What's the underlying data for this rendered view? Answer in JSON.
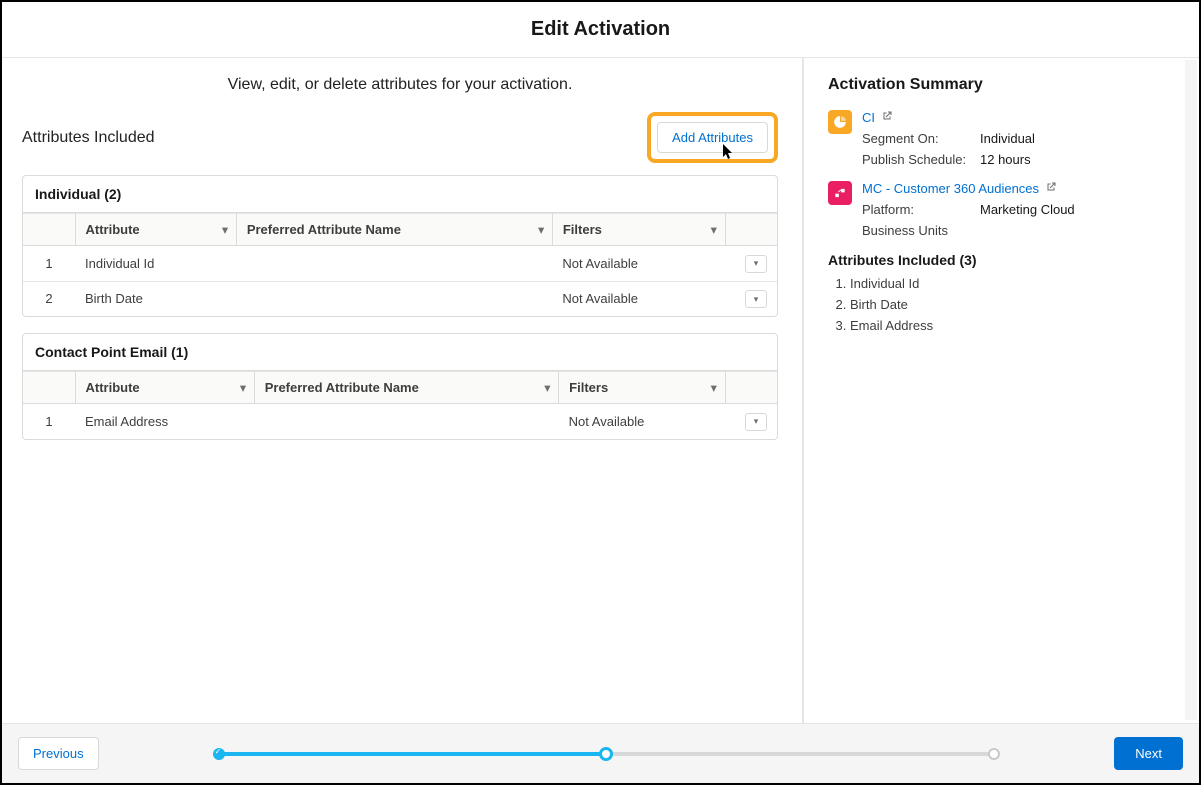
{
  "modal": {
    "title": "Edit Activation"
  },
  "main": {
    "description": "View, edit, or delete attributes for your activation.",
    "attrs_title": "Attributes Included",
    "add_button": "Add Attributes",
    "groups": [
      {
        "title": "Individual (2)",
        "columns": {
          "attr": "Attribute",
          "pref": "Preferred Attribute Name",
          "filters": "Filters"
        },
        "rows": [
          {
            "num": "1",
            "attr": "Individual Id",
            "pref": "",
            "filters": "Not Available"
          },
          {
            "num": "2",
            "attr": "Birth Date",
            "pref": "",
            "filters": "Not Available"
          }
        ]
      },
      {
        "title": "Contact Point Email (1)",
        "columns": {
          "attr": "Attribute",
          "pref": "Preferred Attribute Name",
          "filters": "Filters"
        },
        "rows": [
          {
            "num": "1",
            "attr": "Email Address",
            "pref": "",
            "filters": "Not Available"
          }
        ]
      }
    ]
  },
  "sidebar": {
    "title": "Activation Summary",
    "ci": {
      "link": "CI",
      "segment_on_label": "Segment On:",
      "segment_on_value": "Individual",
      "publish_label": "Publish Schedule:",
      "publish_value": "12 hours"
    },
    "mc": {
      "link": "MC - Customer 360 Audiences",
      "platform_label": "Platform:",
      "platform_value": "Marketing Cloud",
      "bu_label": "Business Units"
    },
    "attrs_title": "Attributes Included (3)",
    "attrs": [
      "Individual Id",
      "Birth Date",
      "Email Address"
    ]
  },
  "footer": {
    "previous": "Previous",
    "next": "Next"
  }
}
